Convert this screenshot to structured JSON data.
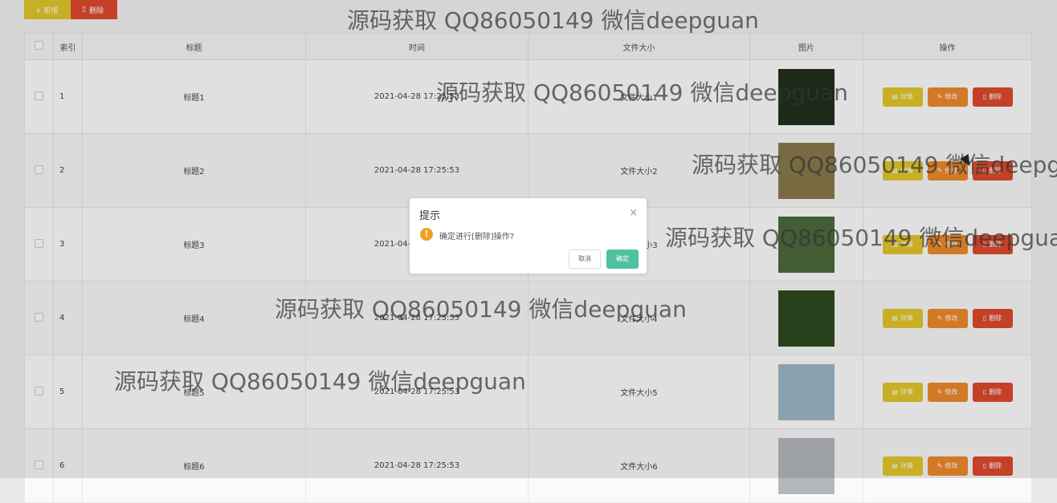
{
  "toolbar": {
    "add_label": "+ 新增",
    "delete_label": "删除"
  },
  "table": {
    "headers": [
      "索引",
      "标题",
      "时间",
      "文件大小",
      "图片",
      "操作"
    ],
    "rows": [
      {
        "index": "1",
        "title": "标题1",
        "time": "2021-04-28 17:25:53",
        "size": "文件大小1",
        "photo_color": "#22301c"
      },
      {
        "index": "2",
        "title": "标题2",
        "time": "2021-04-28 17:25:53",
        "size": "文件大小2",
        "photo_color": "#8a7a4a"
      },
      {
        "index": "3",
        "title": "标题3",
        "time": "2021-04-28 17:25:53",
        "size": "文件大小3",
        "photo_color": "#4d6a3c"
      },
      {
        "index": "4",
        "title": "标题4",
        "time": "2021-04-28 17:25:53",
        "size": "文件大小4",
        "photo_color": "#2e4a22"
      },
      {
        "index": "5",
        "title": "标题5",
        "time": "2021-04-28 17:25:53",
        "size": "文件大小5",
        "photo_color": "#9fb8c8"
      },
      {
        "index": "6",
        "title": "标题6",
        "time": "2021-04-28 17:25:53",
        "size": "文件大小6",
        "photo_color": "#b4b8bc"
      }
    ],
    "actions": {
      "detail": "详情",
      "edit": "修改",
      "delete": "删除"
    }
  },
  "dialog": {
    "title": "提示",
    "close": "×",
    "icon": "!",
    "message": "确定进行[删除]操作?",
    "cancel": "取消",
    "confirm": "确定"
  },
  "watermark": "源码获取 QQ86050149 微信deepguan"
}
